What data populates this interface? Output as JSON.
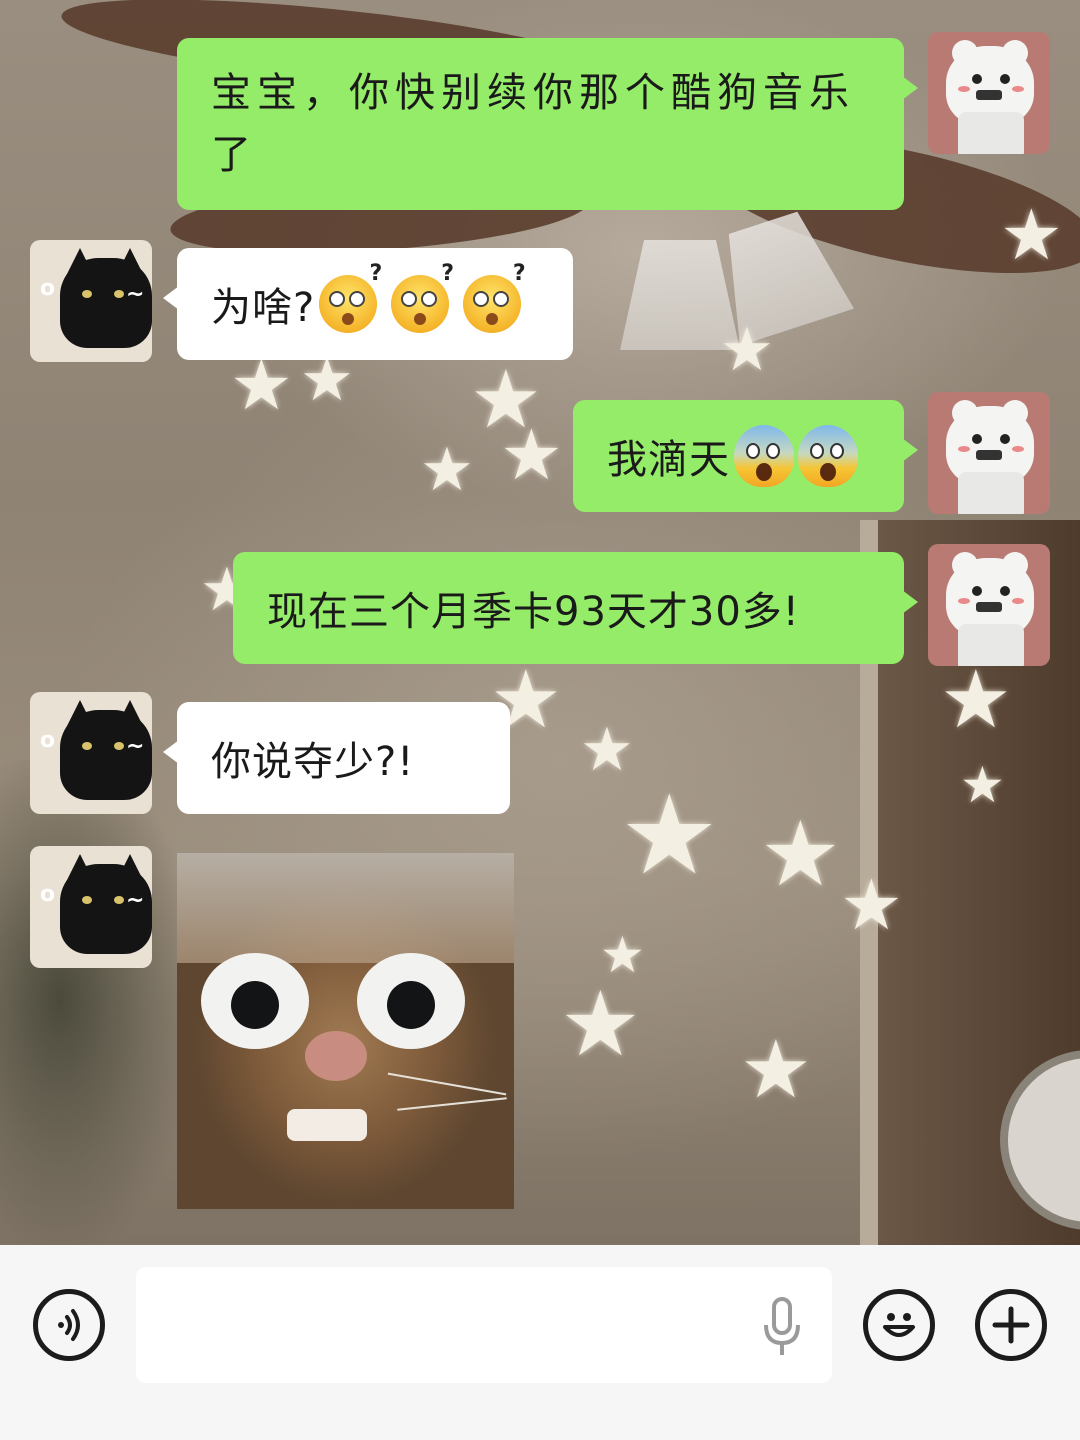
{
  "chat": {
    "messages": [
      {
        "sender": "me",
        "text": "宝宝，你快别续你那个酷狗音乐了"
      },
      {
        "sender": "them",
        "text": "为啥?"
      },
      {
        "sender": "me",
        "text": "我滴天"
      },
      {
        "sender": "me",
        "text": "现在三个月季卡93天才30多!"
      },
      {
        "sender": "them",
        "text": "你说夺少?!"
      },
      {
        "sender": "them",
        "type": "sticker",
        "sticker": "wide-eyed-cat"
      }
    ],
    "line1": "宝宝，你快别续你那个酷狗音乐",
    "line2": "了",
    "q_emoji_mark": "?"
  },
  "input": {
    "placeholder": "",
    "value": ""
  },
  "icons": {
    "voice_toggle": "voice-wave-icon",
    "mic": "microphone-icon",
    "emoji": "smiley-icon",
    "more": "plus-icon"
  },
  "colors": {
    "my_bubble": "#95ec69",
    "their_bubble": "#ffffff",
    "input_bar": "#f6f6f6"
  }
}
